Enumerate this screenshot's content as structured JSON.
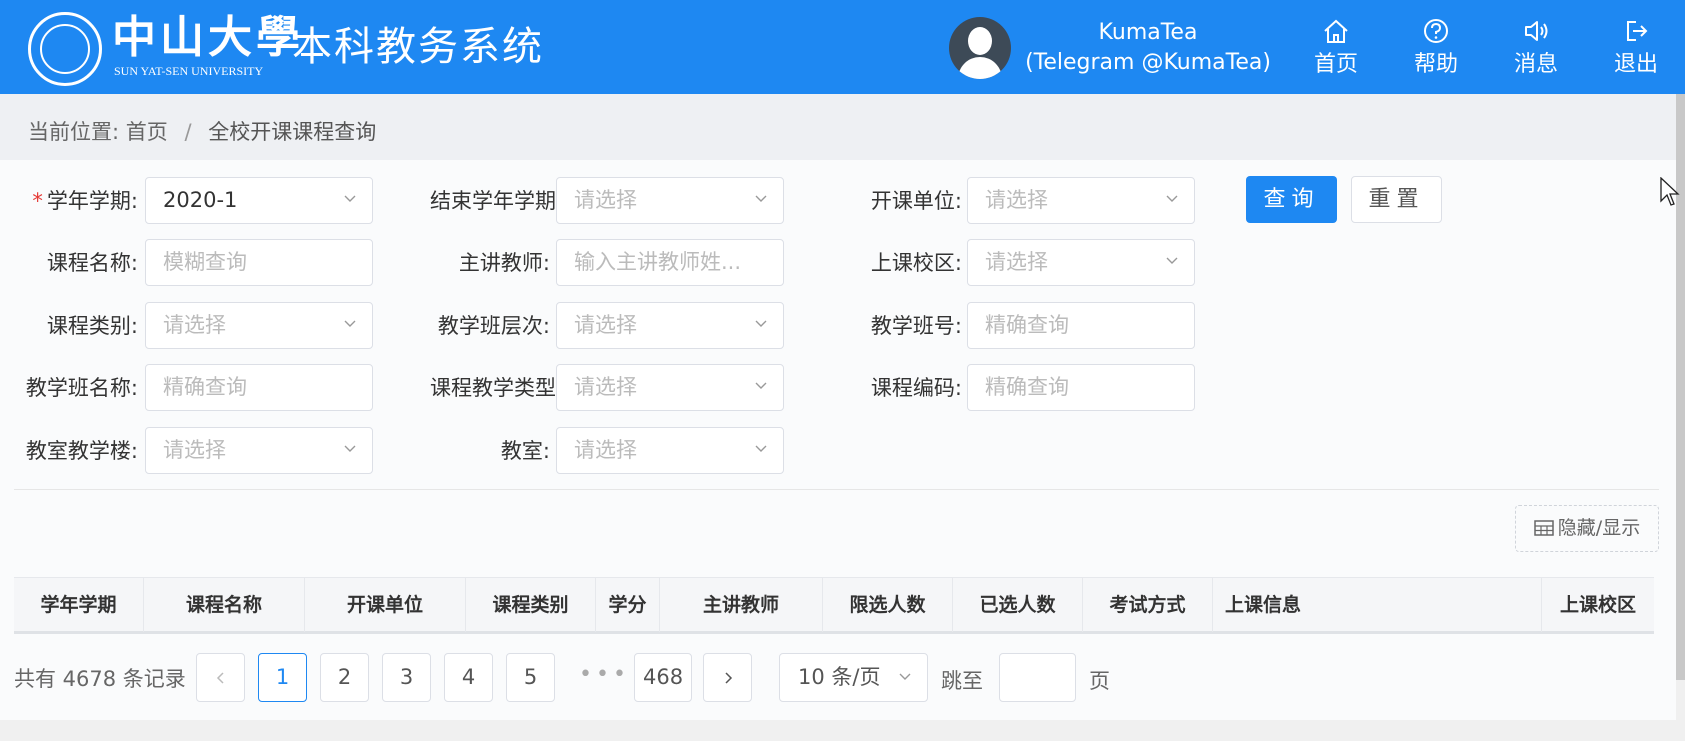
{
  "header": {
    "logo_cn": "中山大學",
    "logo_en": "SUN YAT-SEN UNIVERSITY",
    "system_title": "本科教务系统",
    "user_line1": "KumaTea",
    "user_line2": "(Telegram @KumaTea)",
    "nav": [
      {
        "label": "首页",
        "icon": "home-icon"
      },
      {
        "label": "帮助",
        "icon": "help-icon"
      },
      {
        "label": "消息",
        "icon": "speaker-icon"
      },
      {
        "label": "退出",
        "icon": "logout-icon"
      }
    ],
    "bg_color": "#1e88f2"
  },
  "breadcrumb": {
    "prefix": "当前位置:",
    "home": "首页",
    "separator": "/",
    "current": "全校开课课程查询"
  },
  "form": {
    "required_mark": "*",
    "fields": [
      {
        "label": "学年学期:",
        "value": "2020-1",
        "placeholder": "",
        "type": "select"
      },
      {
        "label": "结束学年学期",
        "value": "",
        "placeholder": "请选择",
        "type": "select"
      },
      {
        "label": "开课单位:",
        "value": "",
        "placeholder": "请选择",
        "type": "select"
      },
      {
        "label": "课程名称:",
        "value": "",
        "placeholder": "模糊查询",
        "type": "input"
      },
      {
        "label": "主讲教师:",
        "value": "",
        "placeholder": "输入主讲教师姓...",
        "type": "input"
      },
      {
        "label": "上课校区:",
        "value": "",
        "placeholder": "请选择",
        "type": "select"
      },
      {
        "label": "课程类别:",
        "value": "",
        "placeholder": "请选择",
        "type": "select"
      },
      {
        "label": "教学班层次:",
        "value": "",
        "placeholder": "请选择",
        "type": "select"
      },
      {
        "label": "教学班号:",
        "value": "",
        "placeholder": "精确查询",
        "type": "input"
      },
      {
        "label": "教学班名称:",
        "value": "",
        "placeholder": "精确查询",
        "type": "input"
      },
      {
        "label": "课程教学类型",
        "value": "",
        "placeholder": "请选择",
        "type": "select"
      },
      {
        "label": "课程编码:",
        "value": "",
        "placeholder": "精确查询",
        "type": "input"
      },
      {
        "label": "教室教学楼:",
        "value": "",
        "placeholder": "请选择",
        "type": "select"
      },
      {
        "label": "教室:",
        "value": "",
        "placeholder": "请选择",
        "type": "select"
      }
    ],
    "query_button": "查询",
    "reset_button": "重置"
  },
  "table": {
    "toggle_label": "隐藏/显示",
    "columns": [
      "学年学期",
      "课程名称",
      "开课单位",
      "课程类别",
      "学分",
      "主讲教师",
      "限选人数",
      "已选人数",
      "考试方式",
      "上课信息",
      "上课校区"
    ]
  },
  "pagination": {
    "total_text": "共有 4678 条记录",
    "pages": [
      "1",
      "2",
      "3",
      "4",
      "5"
    ],
    "ellipsis": "•••",
    "last_page": "468",
    "current_page": "1",
    "page_size": "10 条/页",
    "jump_prefix": "跳至",
    "jump_suffix": "页"
  }
}
